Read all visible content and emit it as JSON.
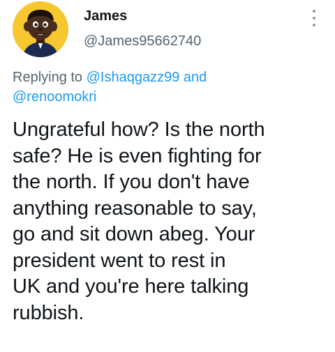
{
  "user": {
    "display_name": "James",
    "handle": "@James95662740",
    "avatar_bg_color": "#f6c72e"
  },
  "reply": {
    "prefix": "Replying to",
    "mention_1": "@Ishaqgazz99",
    "conjunction": "and",
    "mention_2": "@renoomokri"
  },
  "tweet": {
    "lines": [
      "Ungrateful how? Is the north",
      "safe? He is even fighting for",
      "the north. If you don't have",
      "anything reasonable to say,",
      "go and sit down abeg. Your",
      "president went to rest in",
      "UK and you're here talking",
      "rubbish."
    ]
  },
  "colors": {
    "text": "#0f1419",
    "secondary": "#536471",
    "link": "#1d9bf0"
  },
  "icons": {
    "more": "more-vertical-icon"
  }
}
